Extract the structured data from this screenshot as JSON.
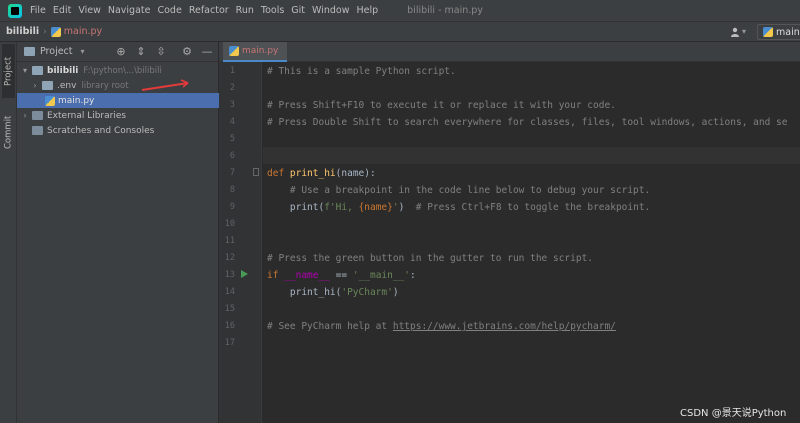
{
  "menubar": {
    "items": [
      "File",
      "Edit",
      "View",
      "Navigate",
      "Code",
      "Refactor",
      "Run",
      "Tools",
      "Git",
      "Window",
      "Help"
    ],
    "window_title": "bilibili - main.py"
  },
  "navbar": {
    "project": "bilibili",
    "file": "main.py",
    "run_config": "main"
  },
  "left_strip": {
    "project_tab": "Project",
    "commit_tab": "Commit"
  },
  "project_panel": {
    "title": "Project",
    "tree": [
      {
        "label": "bilibili",
        "hint": "F:\\python\\...\\bilibili",
        "kind": "root"
      },
      {
        "label": ".env",
        "hint": "library root",
        "kind": "folder"
      },
      {
        "label": "main.py",
        "hint": "",
        "kind": "file"
      },
      {
        "label": "External Libraries",
        "hint": "",
        "kind": "lib"
      },
      {
        "label": "Scratches and Consoles",
        "hint": "",
        "kind": "scratch"
      }
    ]
  },
  "editor": {
    "tab": "main.py",
    "line_numbers": [
      "1",
      "2",
      "3",
      "4",
      "5",
      "6",
      "7",
      "8",
      "9",
      "10",
      "11",
      "12",
      "13",
      "14",
      "15",
      "16",
      "17"
    ],
    "lines": {
      "l1": "# This is a sample Python script.",
      "l3": "# Press Shift+F10 to execute it or replace it with your code.",
      "l4": "# Press Double Shift to search everywhere for classes, files, tool windows, actions, and se",
      "l7_kw": "def ",
      "l7_fn": "print_hi",
      "l7_rest": "(name):",
      "l8": "    # Use a breakpoint in the code line below to debug your script.",
      "l9_a": "    print(",
      "l9_str1": "f'Hi, ",
      "l9_b": "{name}",
      "l9_str2": "'",
      "l9_c": ")  ",
      "l9_cmt": "# Press Ctrl+F8 to toggle the breakpoint.",
      "l12": "# Press the green button in the gutter to run the script.",
      "l13_kw": "if ",
      "l13_d": "__name__",
      "l13_op": " == ",
      "l13_str": "'__main__'",
      "l13_end": ":",
      "l14_a": "    print_hi(",
      "l14_str": "'PyCharm'",
      "l14_b": ")",
      "l16_cmt": "# See PyCharm help at ",
      "l16_link": "https://www.jetbrains.com/help/pycharm/"
    }
  },
  "watermark": "CSDN @景天说Python",
  "colors": {
    "keyword": "#cc7832",
    "function": "#ffc66d",
    "string": "#6a8759",
    "comment": "#808080",
    "selection": "#4b6eaf"
  }
}
